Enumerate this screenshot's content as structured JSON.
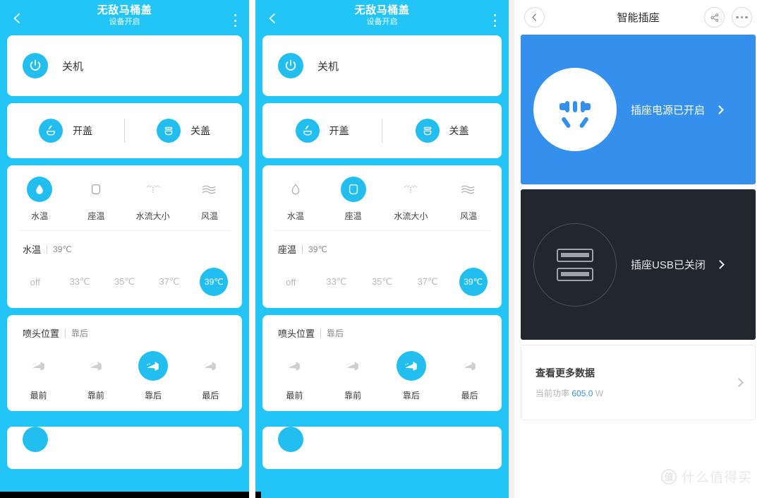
{
  "colors": {
    "cyan_bg": "#22C5F6",
    "accent_blue": "#22BEF0",
    "plug_blue": "#3490EC",
    "usb_dark": "#22262E",
    "power_value": "#3490EC"
  },
  "toilet": {
    "title": "无敌马桶盖",
    "subtitle": "设备开启",
    "back_icon": "chevron-left-icon",
    "more_icon": "more-vertical-icon",
    "power": {
      "label": "关机",
      "icon": "power-icon"
    },
    "lid": {
      "open": {
        "label": "开盖",
        "icon": "lid-open-icon"
      },
      "close": {
        "label": "关盖",
        "icon": "lid-close-icon"
      }
    },
    "modes": [
      {
        "label": "水温",
        "icon": "water-drop-icon"
      },
      {
        "label": "座温",
        "icon": "toilet-seat-icon"
      },
      {
        "label": "水流大小",
        "icon": "water-flow-icon"
      },
      {
        "label": "风温",
        "icon": "wind-icon"
      }
    ],
    "temp_options": [
      "off",
      "33℃",
      "35℃",
      "37℃",
      "39℃"
    ],
    "temp_selected": "39℃",
    "nozzle": {
      "title": "喷头位置",
      "value": "靠后",
      "options": [
        "最前",
        "靠前",
        "靠后",
        "最后"
      ],
      "selected": "靠后",
      "icon": "nozzle-icon"
    },
    "panel1": {
      "active_mode": "水温",
      "mode_head_name": "水温",
      "mode_head_value": "39℃"
    },
    "panel2": {
      "active_mode": "座温",
      "mode_head_name": "座温",
      "mode_head_value": "39℃"
    }
  },
  "plug": {
    "title": "智能插座",
    "back_icon": "chevron-left-circle-icon",
    "share_icon": "share-icon",
    "more_icon": "more-horizontal-icon",
    "power_card": {
      "status": "插座电源已开启",
      "icon": "power-socket-icon",
      "chevron": "chevron-right-icon"
    },
    "usb_card": {
      "status": "插座USB已关闭",
      "icon": "usb-ports-icon",
      "chevron": "chevron-right-icon"
    },
    "data_card": {
      "title": "查看更多数据",
      "sub_prefix": "当前功率",
      "sub_value": "605.0",
      "sub_unit": "W",
      "chevron": "chevron-right-icon"
    }
  },
  "watermark": {
    "logo": "值",
    "text": "什么值得买"
  }
}
